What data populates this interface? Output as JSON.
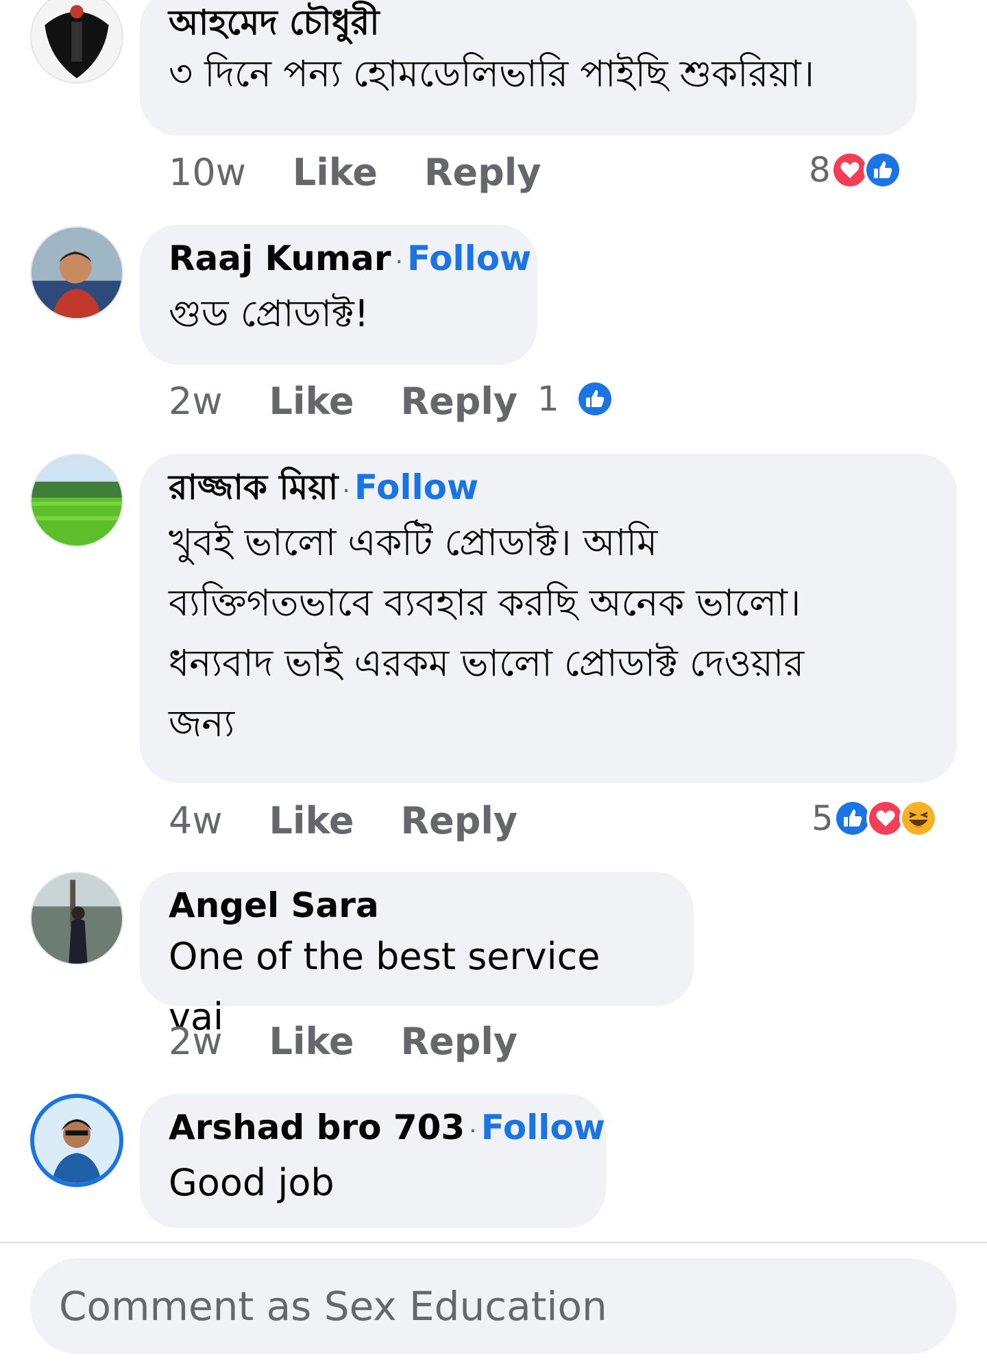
{
  "comments": [
    {
      "author": "আহমেদ চৌধুরী",
      "follow": "",
      "text": "৩ দিনে পন্য হোমডেলিভারি পাইছি শুকরিয়া।",
      "time": "10w",
      "like": "Like",
      "reply": "Reply",
      "reaction_count": "8",
      "reactions": [
        "love-reaction-icon",
        "like-reaction-icon"
      ]
    },
    {
      "author": "Raaj Kumar",
      "follow": "Follow",
      "text": "গুড প্রোডাক্ট!",
      "time": "2w",
      "like": "Like",
      "reply": "Reply",
      "reaction_count": "1",
      "reactions": [
        "like-reaction-icon"
      ]
    },
    {
      "author": "রাজ্জাক মিয়া",
      "follow": "Follow",
      "text_lines": [
        "খুবই ভালো একটি প্রোডাক্ট।  আমি",
        "ব্যক্তিগতভাবে ব্যবহার করছি অনেক ভালো।",
        "ধন্যবাদ ভাই এরকম ভালো প্রোডাক্ট দেওয়ার",
        "জন্য"
      ],
      "time": "4w",
      "like": "Like",
      "reply": "Reply",
      "reaction_count": "5",
      "reactions": [
        "like-reaction-icon",
        "love-reaction-icon",
        "haha-reaction-icon"
      ]
    },
    {
      "author": "Angel Sara",
      "follow": "",
      "text": "One of the best service vai",
      "time": "2w",
      "like": "Like",
      "reply": "Reply",
      "reaction_count": "",
      "reactions": []
    },
    {
      "author": "Arshad bro 703",
      "follow": "Follow",
      "text": "Good job",
      "time": "",
      "like": "",
      "reply": "",
      "reaction_count": "",
      "reactions": []
    }
  ],
  "composer": {
    "placeholder": "Comment as Sex Education"
  },
  "colors": {
    "accent": "#1b74e4",
    "bubble": "#f0f2f5",
    "meta_text": "#65676b",
    "love": "#f33e58",
    "haha": "#f7b125"
  }
}
